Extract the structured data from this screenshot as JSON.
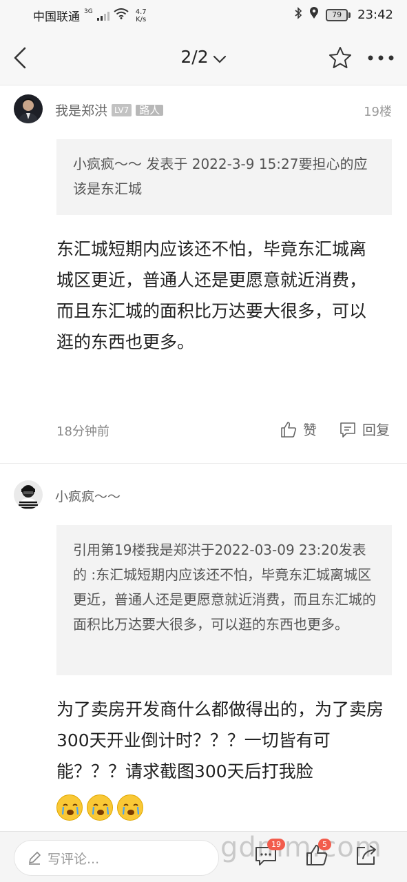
{
  "status_bar": {
    "carrier": "中国联通",
    "network": "3G",
    "speed_value": "4.7",
    "speed_unit": "K/s",
    "battery": "79",
    "time": "23:42"
  },
  "nav": {
    "page_indicator": "2/2"
  },
  "post1": {
    "username": "我是郑洪",
    "level": "LV7",
    "role": "路人",
    "floor": "19楼",
    "quote": "小疯疯～～ 发表于 2022-3-9 15:27要担心的应该是东汇城",
    "body": "东汇城短期内应该还不怕，毕竟东汇城离城区更近，普通人还是更愿意就近消费，而且东汇城的面积比万达要大很多，可以逛的东西也更多。",
    "time": "18分钟前",
    "like_label": "赞",
    "reply_label": "回复"
  },
  "post2": {
    "username": "小疯疯～～",
    "quote": "引用第19楼我是郑洪于2022-03-09 23:20发表的 :东汇城短期内应该还不怕，毕竟东汇城离城区更近，普通人还是更愿意就近消费，而且东汇城的面积比万达要大很多，可以逛的东西也更多。",
    "body": "为了卖房开发商什么都做得出的，为了卖房300天开业倒计时？？？一切皆有可能？？？请求截图300天后打我脸"
  },
  "bottom_bar": {
    "comment_placeholder": "写评论...",
    "comment_count": "19",
    "like_count": "5",
    "watermark": "gdmm.com"
  }
}
